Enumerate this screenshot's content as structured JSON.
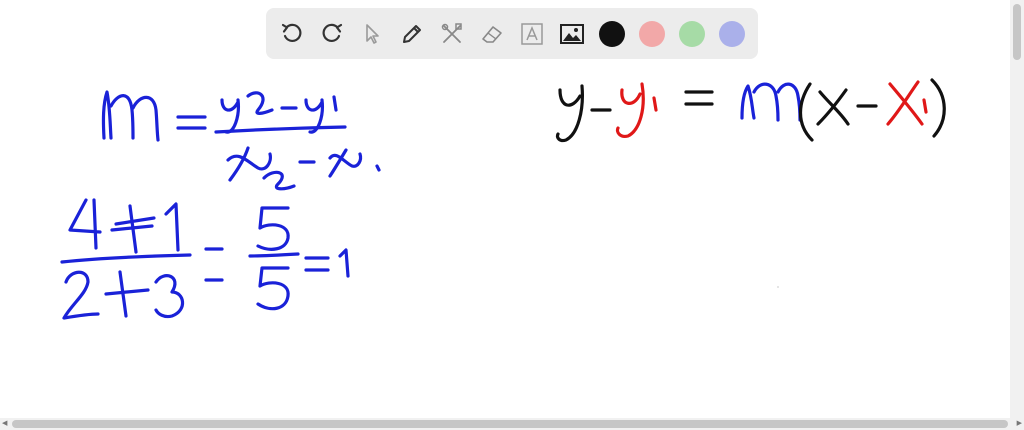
{
  "toolbar": {
    "tools": [
      {
        "name": "undo-icon"
      },
      {
        "name": "redo-icon"
      },
      {
        "name": "select-pointer-icon"
      },
      {
        "name": "pen-icon"
      },
      {
        "name": "tools-icon"
      },
      {
        "name": "eraser-icon"
      },
      {
        "name": "text-icon"
      },
      {
        "name": "image-icon"
      }
    ],
    "colors": [
      "#111111",
      "#f2a8a8",
      "#a6dba6",
      "#aab0ea"
    ]
  },
  "canvas": {
    "ink_colors": {
      "blue": "#1a22d8",
      "black": "#111111",
      "red": "#e01818"
    }
  }
}
